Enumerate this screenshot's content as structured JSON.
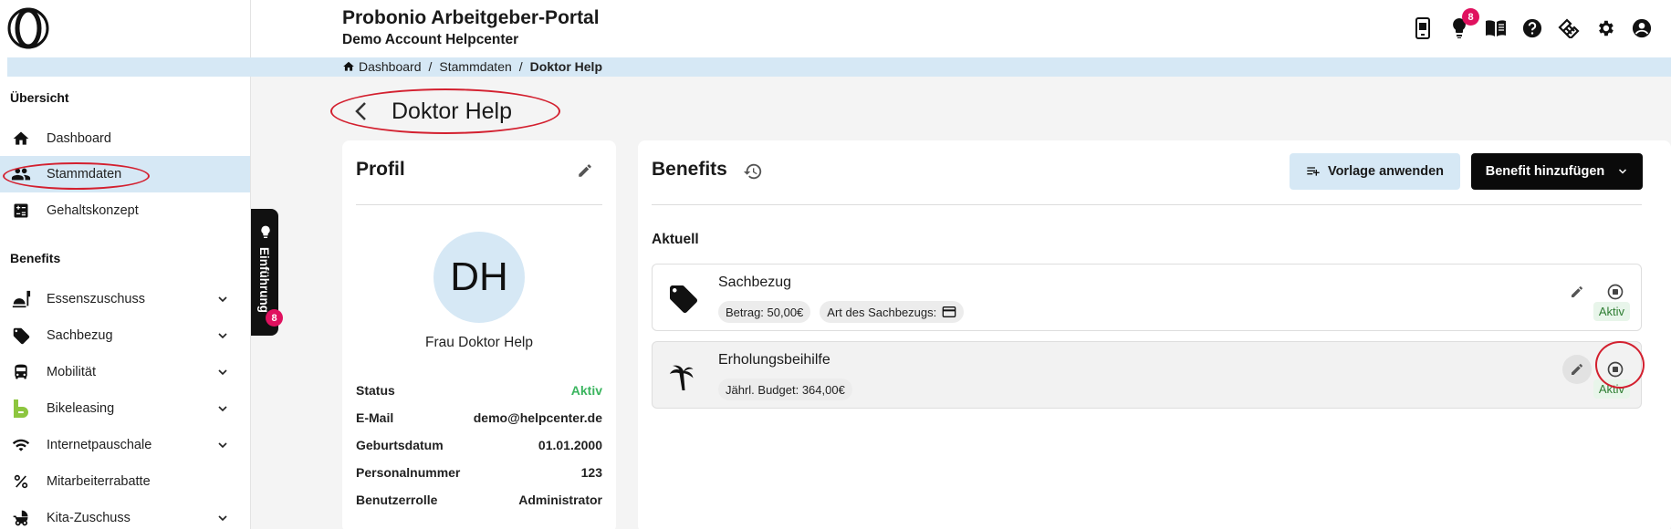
{
  "header": {
    "app_title": "Probonio Arbeitgeber-Portal",
    "account": "Demo Account Helpcenter",
    "notifications_count": "8",
    "icons": [
      "mobile-app-icon",
      "lightbulb-icon",
      "book-icon",
      "help-icon",
      "handshake-icon",
      "gear-icon",
      "account-icon"
    ]
  },
  "breadcrumb": {
    "items": [
      "Dashboard",
      "Stammdaten",
      "Doktor Help"
    ],
    "separator": "/"
  },
  "sidebar": {
    "section_overview": "Übersicht",
    "section_benefits": "Benefits",
    "items": [
      {
        "label": "Dashboard",
        "icon": "home-icon"
      },
      {
        "label": "Stammdaten",
        "icon": "people-icon",
        "active": true
      },
      {
        "label": "Gehaltskonzept",
        "icon": "calculator-icon"
      }
    ],
    "benefit_items": [
      {
        "label": "Essenszuschuss",
        "icon": "meal-icon"
      },
      {
        "label": "Sachbezug",
        "icon": "tag-icon"
      },
      {
        "label": "Mobilität",
        "icon": "bus-icon"
      },
      {
        "label": "Bikeleasing",
        "icon": "bikeleasing-icon"
      },
      {
        "label": "Internetpauschale",
        "icon": "wifi-icon"
      },
      {
        "label": "Mitarbeiterrabatte",
        "icon": "percent-icon"
      },
      {
        "label": "Kita-Zuschuss",
        "icon": "stroller-icon"
      }
    ]
  },
  "intro_tab": {
    "label": "Einführung",
    "badge": "8"
  },
  "page": {
    "title": "Doktor Help"
  },
  "profile": {
    "title": "Profil",
    "initials": "DH",
    "name": "Frau Doktor Help",
    "fields": [
      {
        "key": "Status",
        "value": "Aktiv"
      },
      {
        "key": "E-Mail",
        "value": "demo@helpcenter.de"
      },
      {
        "key": "Geburtsdatum",
        "value": "01.01.2000"
      },
      {
        "key": "Personalnummer",
        "value": "123"
      },
      {
        "key": "Benutzerrolle",
        "value": "Administrator"
      }
    ]
  },
  "benefits": {
    "title": "Benefits",
    "apply_template": "Vorlage anwenden",
    "add_benefit": "Benefit hinzufügen",
    "section_current": "Aktuell",
    "rows": [
      {
        "name": "Sachbezug",
        "chips": [
          "Betrag: 50,00€",
          "Art des Sachbezugs:"
        ],
        "status": "Aktiv",
        "icon": "tag-icon"
      },
      {
        "name": "Erholungsbeihilfe",
        "chips": [
          "Jährl. Budget: 364,00€"
        ],
        "status": "Aktiv",
        "icon": "palm-tree-icon"
      }
    ]
  },
  "colors": {
    "accent_light": "#d6e8f5",
    "active_green": "#3bb55f",
    "badge": "#e0115f",
    "annotation": "#d3202f"
  }
}
